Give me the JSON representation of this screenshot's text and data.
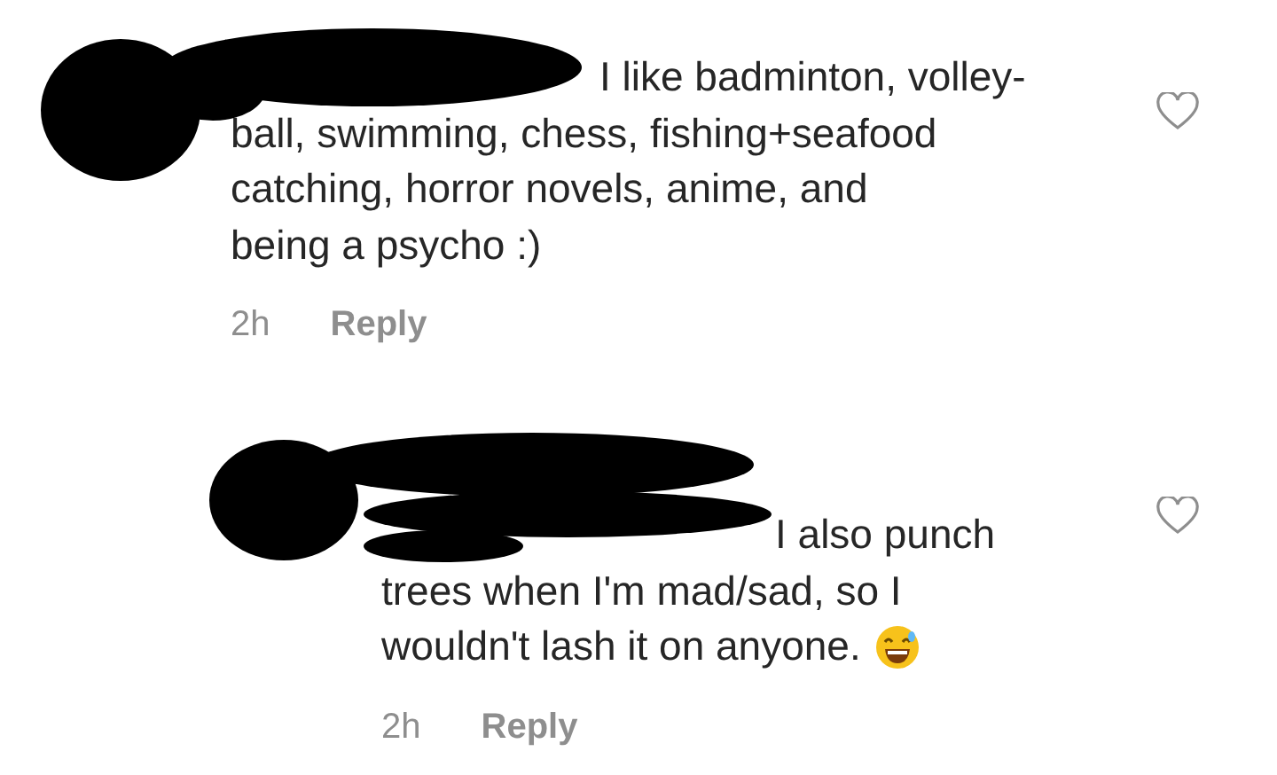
{
  "comments": [
    {
      "lines": [
        "I like badminton, volley-",
        "ball, swimming, chess, fishing+seafood",
        "catching, horror novels, anime, and",
        "being a psycho :)"
      ],
      "time": "2h",
      "reply": "Reply",
      "liked": false,
      "kind": "comment"
    },
    {
      "lines": [
        "I also punch",
        "trees when I'm mad/sad, so I",
        "wouldn't lash it on anyone."
      ],
      "emoji": true,
      "time": "2h",
      "reply": "Reply",
      "liked": false,
      "kind": "reply"
    }
  ]
}
